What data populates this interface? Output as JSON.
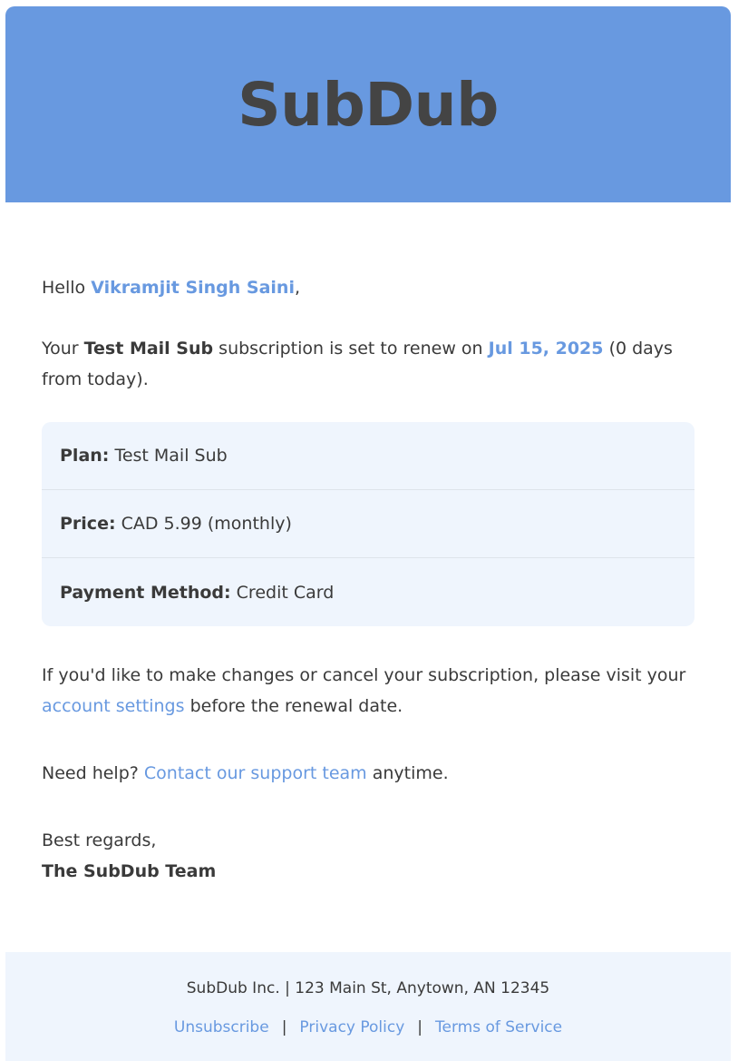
{
  "header": {
    "brand": "SubDub",
    "brand_color": "#6899e0"
  },
  "greeting": {
    "prefix": "Hello",
    "name": "Vikramjit Singh Saini",
    "suffix": ","
  },
  "renewal": {
    "prefix": "Your",
    "subscription_name": "Test Mail Sub",
    "middle": "subscription is set to renew on",
    "date": "Jul 15, 2025",
    "suffix": "(0 days from today)."
  },
  "details": [
    {
      "label": "Plan:",
      "value": "Test Mail Sub"
    },
    {
      "label": "Price:",
      "value": "CAD 5.99 (monthly)"
    },
    {
      "label": "Payment Method:",
      "value": "Credit Card"
    }
  ],
  "changes": {
    "prefix": "If you'd like to make changes or cancel your subscription, please visit your",
    "link_text": "account settings",
    "suffix": "before the renewal date."
  },
  "help": {
    "prefix": "Need help?",
    "link_text": "Contact our support team",
    "suffix": "anytime."
  },
  "signoff": {
    "regards": "Best regards,",
    "team": "The SubDub Team"
  },
  "footer": {
    "address": "SubDub Inc. | 123 Main St, Anytown, AN 12345",
    "links": [
      "Unsubscribe",
      "Privacy Policy",
      "Terms of Service"
    ],
    "separator": "|"
  }
}
